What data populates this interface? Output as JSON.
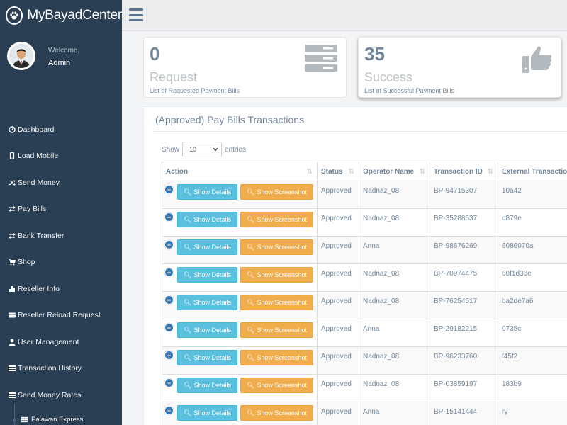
{
  "brand": {
    "title": "MyBayadCenter"
  },
  "profile": {
    "welcome": "Welcome,",
    "name": "Admin"
  },
  "menu": [
    {
      "label": "Dashboard",
      "icon": "dashboard-icon"
    },
    {
      "label": "Load Mobile",
      "icon": "mobile-icon"
    },
    {
      "label": "Send Money",
      "icon": "random-icon"
    },
    {
      "label": "Pay Bills",
      "icon": "exchange-icon"
    },
    {
      "label": "Bank Transfer",
      "icon": "exchange-icon"
    },
    {
      "label": "Shop",
      "icon": "cart-icon"
    },
    {
      "label": "Reseller Info",
      "icon": "bar-chart-icon"
    },
    {
      "label": "Reseller Reload Request",
      "icon": "credit-card-icon"
    },
    {
      "label": "User Management",
      "icon": "user-icon"
    },
    {
      "label": "Transaction History",
      "icon": "list-icon"
    },
    {
      "label": "Send Money Rates",
      "icon": "list-icon"
    }
  ],
  "submenu": [
    {
      "label": "Palawan Express",
      "icon": "list-icon"
    }
  ],
  "tiles": [
    {
      "count": "0",
      "title": "Request",
      "desc": "List of Requested Payment Bills",
      "icon": "server-icon"
    },
    {
      "count": "35",
      "title": "Success",
      "desc": "List of Successful Payment Bills",
      "icon": "thumbs-up-icon"
    }
  ],
  "panel": {
    "title": "(Approved) Pay Bills Transactions"
  },
  "length": {
    "show": "Show",
    "value": "10",
    "entries": "entries"
  },
  "table": {
    "headers": [
      "Action",
      "Status",
      "Operator Name",
      "Transaction ID",
      "External Transaction"
    ],
    "buttons": {
      "details": "Show Details",
      "screenshot": "Show Screenshot"
    },
    "rows": [
      {
        "status": "Approved",
        "operator": "Nadnaz_08",
        "txid": "BP-94715307",
        "ext": "10a42"
      },
      {
        "status": "Approved",
        "operator": "Nadnaz_08",
        "txid": "BP-35288537",
        "ext": "d879e"
      },
      {
        "status": "Approved",
        "operator": "Anna",
        "txid": "BP-98676269",
        "ext": "6086070a"
      },
      {
        "status": "Approved",
        "operator": "Nadnaz_08",
        "txid": "BP-70974475",
        "ext": "60f1d36e"
      },
      {
        "status": "Approved",
        "operator": "Nadnaz_08",
        "txid": "BP-76254517",
        "ext": "ba2de7a6"
      },
      {
        "status": "Approved",
        "operator": "Anna",
        "txid": "BP-29182215",
        "ext": "0735c"
      },
      {
        "status": "Approved",
        "operator": "Nadnaz_08",
        "txid": "BP-96233760",
        "ext": "f45f2"
      },
      {
        "status": "Approved",
        "operator": "Nadnaz_08",
        "txid": "BP-03859197",
        "ext": "183b9"
      },
      {
        "status": "Approved",
        "operator": "Anna",
        "txid": "BP-15141444",
        "ext": "ry"
      }
    ]
  },
  "colors": {
    "sidebar": "#2a3f54",
    "info": "#5bc0de",
    "warning": "#f0ad4e",
    "text_muted": "#73879c"
  }
}
